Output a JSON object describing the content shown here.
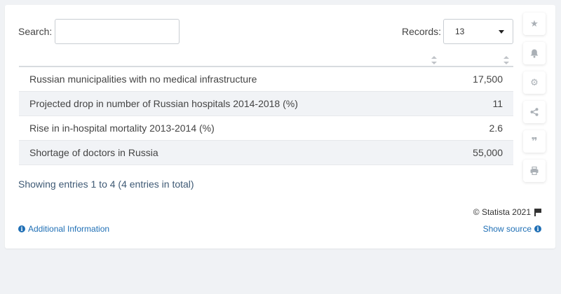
{
  "search": {
    "label": "Search:",
    "value": "",
    "placeholder": ""
  },
  "records": {
    "label": "Records:",
    "selected": "13"
  },
  "table": {
    "rows": [
      {
        "label": "Russian municipalities with no medical infrastructure",
        "value": "17,500"
      },
      {
        "label": "Projected drop in number of Russian hospitals 2014-2018 (%)",
        "value": "11"
      },
      {
        "label": "Rise in in-hospital mortality 2013-2014 (%)",
        "value": "2.6"
      },
      {
        "label": "Shortage of doctors in Russia",
        "value": "55,000"
      }
    ]
  },
  "footer": {
    "showing": "Showing entries 1 to 4 (4 entries in total)",
    "copyright": "© Statista 2021",
    "additional_info": "Additional Information",
    "show_source": "Show source"
  },
  "sidebar_icons": [
    "star-icon",
    "bell-icon",
    "gear-icon",
    "share-icon",
    "quote-icon",
    "print-icon"
  ],
  "colors": {
    "link": "#1f6fb5",
    "alt_row": "#f1f3f6",
    "page_bg": "#f0f2f5"
  }
}
